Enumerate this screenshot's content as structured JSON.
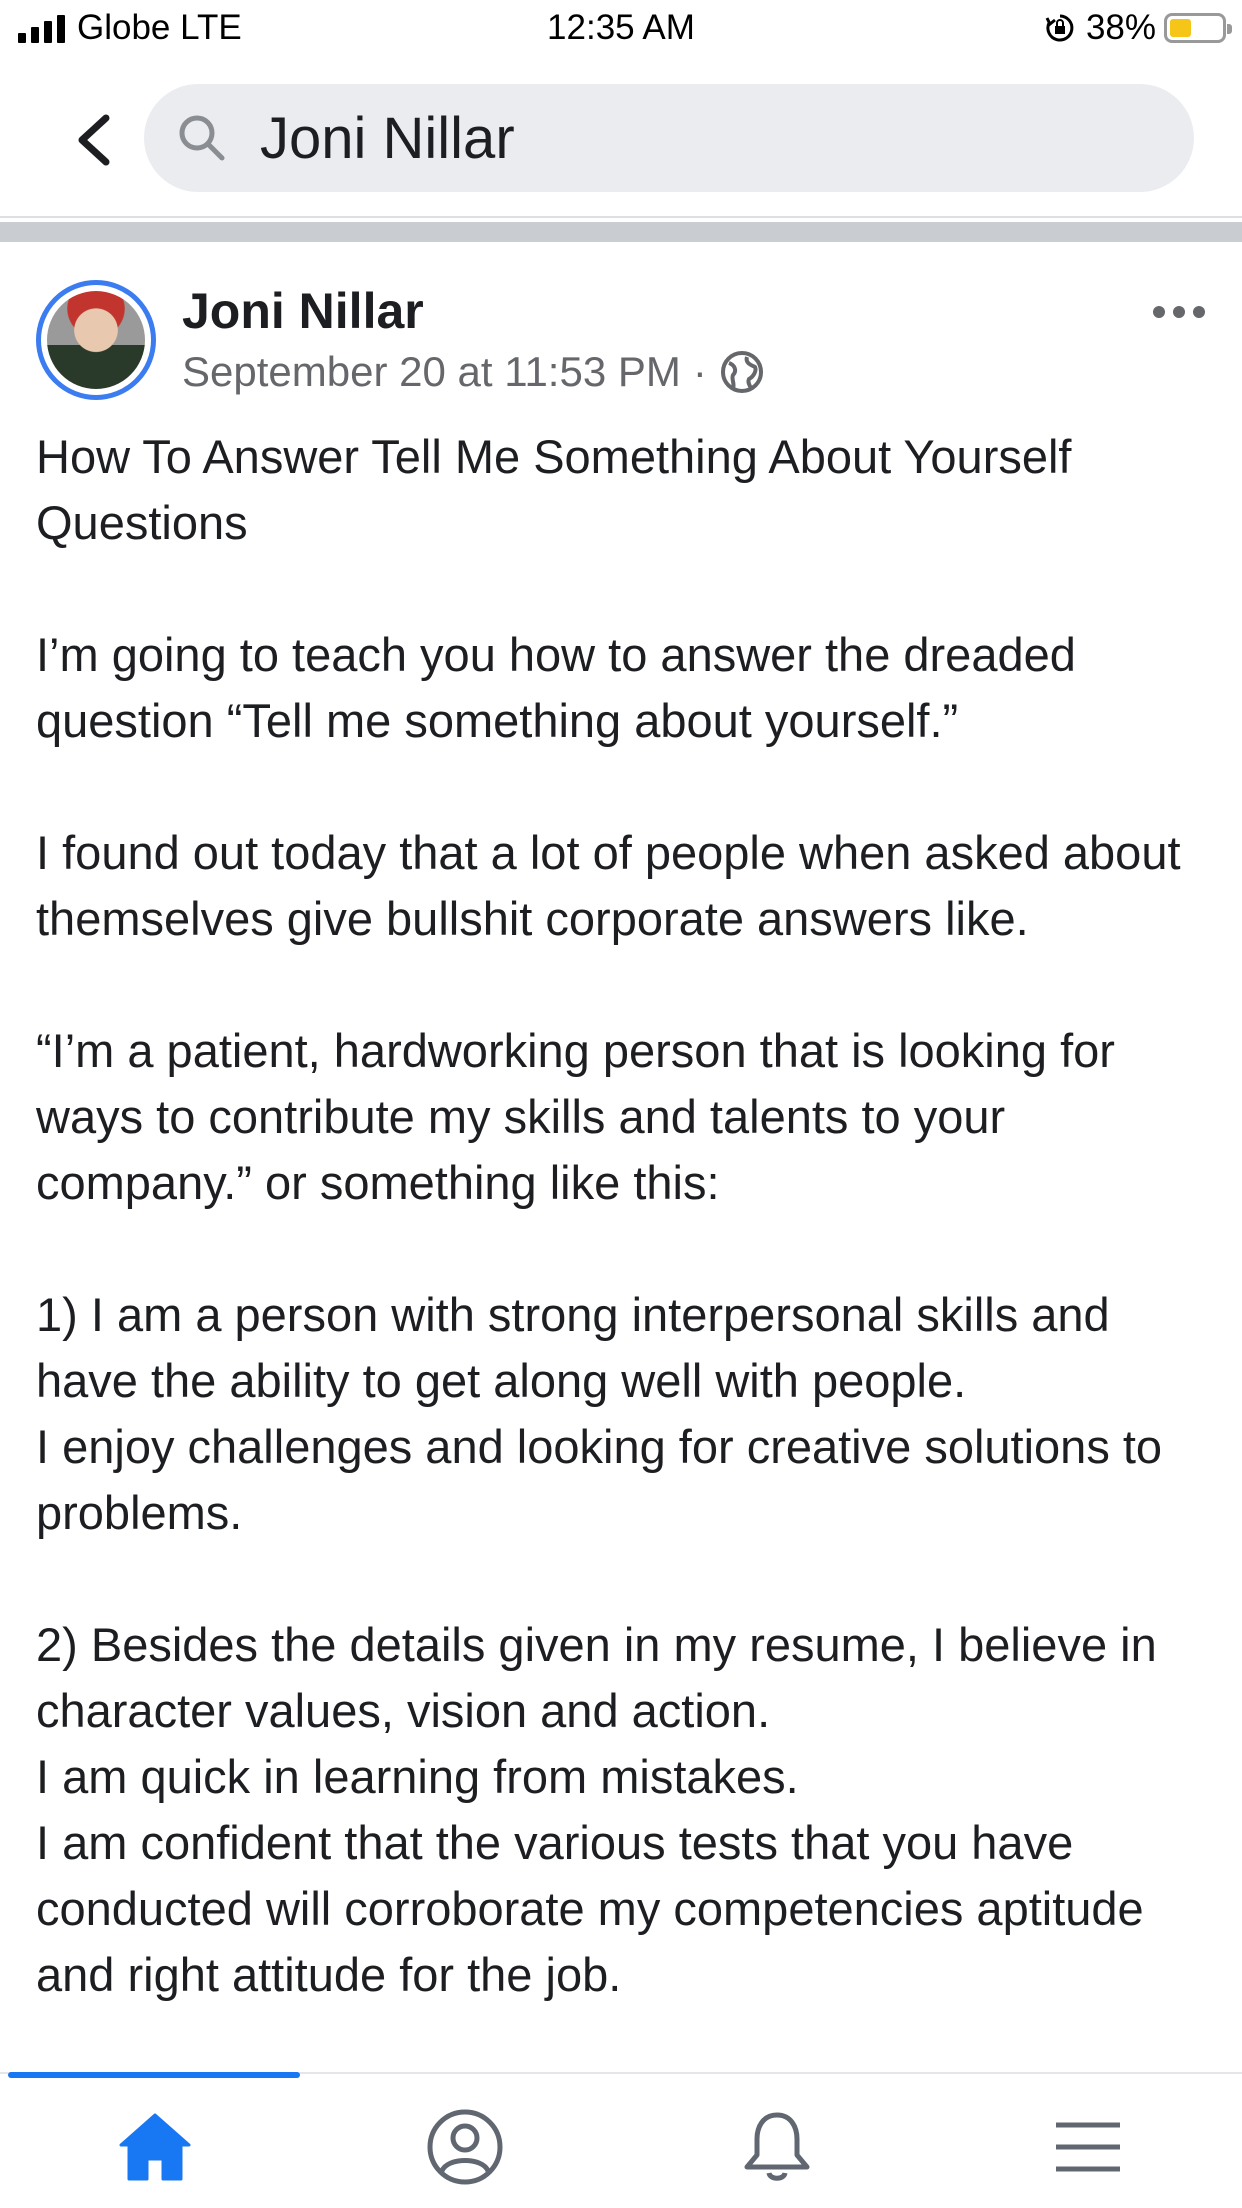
{
  "status_bar": {
    "carrier": "Globe LTE",
    "time": "12:35 AM",
    "battery_percent": "38%",
    "battery_level": 0.38,
    "icons": [
      "signal-icon",
      "rotation-lock-icon",
      "battery-icon"
    ]
  },
  "search": {
    "query": "Joni Nillar",
    "icons": [
      "back-arrow-icon",
      "search-icon"
    ]
  },
  "post": {
    "author": "Joni Nillar",
    "timestamp": "September 20 at 11:53 PM",
    "separator": "·",
    "privacy_icon": "globe-icon",
    "menu_icon": "more-icon",
    "paragraphs": [
      "How To Answer Tell Me Something About Yourself Questions",
      "I’m going to teach you how to answer the dreaded question “Tell me something about yourself.”",
      "I found out today that a lot of people when asked about themselves give bullshit corporate answers like.",
      "“I’m a patient, hardworking person that is looking for ways to contribute my skills and talents to your company.” or something like this:",
      "1) I am a person with strong interpersonal skills and have the ability to get along well with people.",
      "I enjoy challenges and looking for creative solutions to problems.",
      "2) Besides the details given in my resume, I believe in character values, vision and action.",
      "I am quick in learning from mistakes.",
      "I am confident that the various tests that you have conducted will corroborate my competencies aptitude and right attitude for the job."
    ]
  },
  "tab_bar": {
    "active_tab": "home",
    "tabs": [
      "home-icon",
      "profile-icon",
      "notifications-bell-icon",
      "menu-icon"
    ],
    "accent_color": "#1877f2"
  }
}
